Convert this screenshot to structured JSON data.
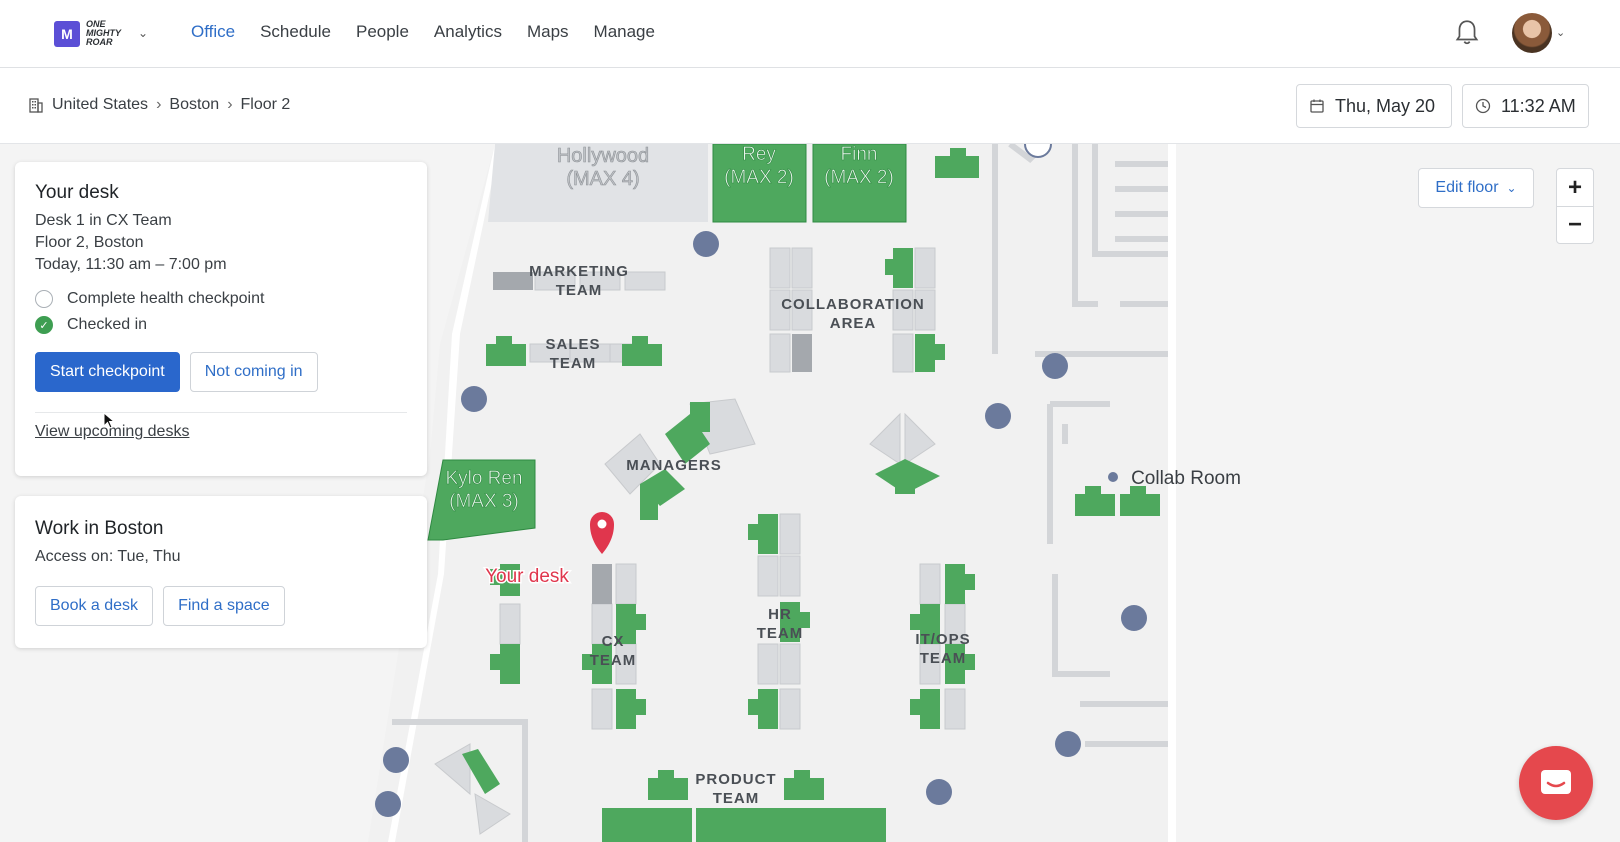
{
  "brand": {
    "logo_text": "ONE MIGHTY ROAR",
    "accent": "#2a67cc",
    "desk_green": "#3e9e52",
    "pin_red": "#e0364d"
  },
  "nav": {
    "items": [
      "Office",
      "Schedule",
      "People",
      "Analytics",
      "Maps",
      "Manage"
    ],
    "active": "Office"
  },
  "breadcrumb": {
    "items": [
      "United States",
      "Boston",
      "Floor 2"
    ],
    "icon": "building-icon"
  },
  "date_picker": {
    "label": "Thu, May 20",
    "icon": "calendar-icon"
  },
  "time_picker": {
    "label": "11:32 AM",
    "icon": "clock-icon"
  },
  "your_desk": {
    "title": "Your desk",
    "desk": "Desk 1 in CX Team",
    "location": "Floor 2, Boston",
    "time": "Today, 11:30 am – 7:00 pm",
    "checklist": [
      {
        "label": "Complete health checkpoint",
        "done": false
      },
      {
        "label": "Checked in",
        "done": true
      }
    ],
    "primary_button": "Start checkpoint",
    "secondary_button": "Not coming in",
    "link": "View upcoming desks"
  },
  "work_in": {
    "title": "Work in Boston",
    "access": "Access on: Tue, Thu",
    "buttons": [
      "Book a desk",
      "Find a space"
    ]
  },
  "map": {
    "edit_floor": "Edit floor",
    "zoom_in": "+",
    "zoom_out": "−",
    "rooms": {
      "hollywood": [
        "Hollywood",
        "(MAX 4)"
      ],
      "rey": [
        "Rey",
        "(MAX 2)"
      ],
      "finn": [
        "Finn",
        "(MAX 2)"
      ],
      "kylo": [
        "Kylo Ren",
        "(MAX 3)"
      ]
    },
    "areas": {
      "marketing": [
        "MARKETING",
        "TEAM"
      ],
      "sales": [
        "SALES",
        "TEAM"
      ],
      "collab": [
        "COLLABORATION",
        "AREA"
      ],
      "managers": [
        "MANAGERS"
      ],
      "hr": [
        "HR",
        "TEAM"
      ],
      "cx": [
        "CX",
        "TEAM"
      ],
      "itops": [
        "IT/OPS",
        "TEAM"
      ],
      "product": [
        "PRODUCT",
        "TEAM"
      ]
    },
    "your_desk_label": "Your desk",
    "collab_room_label": "Collab Room"
  }
}
